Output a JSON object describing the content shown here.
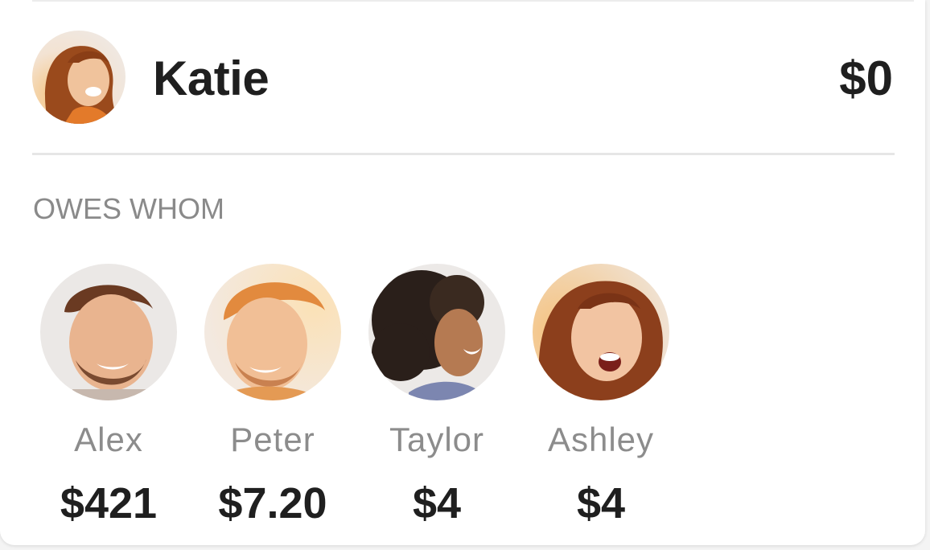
{
  "user": {
    "name": "Katie",
    "balance": "$0",
    "avatar": "katie-avatar-photo"
  },
  "section": {
    "label": "OWES WHOM"
  },
  "creditors": [
    {
      "name": "Alex",
      "amount": "$421",
      "avatar": "alex-avatar-photo"
    },
    {
      "name": "Peter",
      "amount": "$7.20",
      "avatar": "peter-avatar-photo"
    },
    {
      "name": "Taylor",
      "amount": "$4",
      "avatar": "taylor-avatar-photo"
    },
    {
      "name": "Ashley",
      "amount": "$4",
      "avatar": "ashley-avatar-photo"
    }
  ],
  "colors": {
    "text_primary": "#1f1f1f",
    "text_secondary": "#8a8a8a",
    "divider": "#e6e6e6",
    "warm_accent": "#e8892c"
  }
}
